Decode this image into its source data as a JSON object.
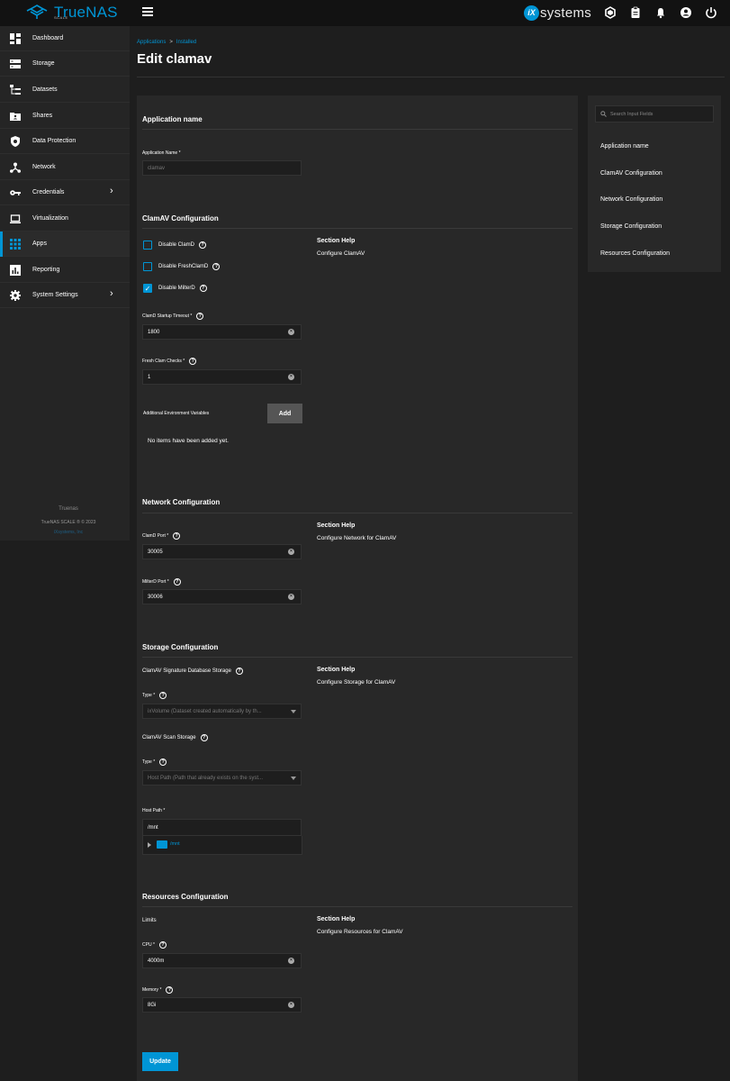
{
  "brand": {
    "name": "TrueNAS",
    "edition": "SCALE",
    "vendor_mark": "iX",
    "vendor_text": "systems"
  },
  "sidebar": {
    "items": [
      {
        "label": "Dashboard",
        "icon": "dashboard-icon"
      },
      {
        "label": "Storage",
        "icon": "storage-icon"
      },
      {
        "label": "Datasets",
        "icon": "datasets-icon"
      },
      {
        "label": "Shares",
        "icon": "shares-icon"
      },
      {
        "label": "Data Protection",
        "icon": "shield-icon"
      },
      {
        "label": "Network",
        "icon": "network-icon"
      },
      {
        "label": "Credentials",
        "icon": "key-icon"
      },
      {
        "label": "Virtualization",
        "icon": "laptop-icon"
      },
      {
        "label": "Apps",
        "icon": "apps-grid-icon"
      },
      {
        "label": "Reporting",
        "icon": "reporting-icon"
      },
      {
        "label": "System Settings",
        "icon": "gear-icon"
      }
    ],
    "footer_hostname": "Truenas",
    "footer_copyright": "TrueNAS SCALE ® © 2023",
    "footer_company": "iXsystems, Inc"
  },
  "breadcrumb": {
    "parent": "Applications",
    "separator": ">",
    "current": "Installed"
  },
  "page_title": "Edit clamav",
  "sections": {
    "app_name": {
      "title": "Application name",
      "field_label": "Application Name *",
      "field_value": "clamav"
    },
    "clamav": {
      "title": "ClamAV Configuration",
      "disable_clamd": "Disable ClamD",
      "disable_freshclamd": "Disable FreshClamD",
      "disable_milterd": "Disable MilterD",
      "startup_timeout_label": "ClamD Startup Timeout *",
      "startup_timeout_value": "1800",
      "fresh_checks_label": "Fresh Clam Checks *",
      "fresh_checks_value": "1",
      "env_vars_label": "Additional Environment Variables",
      "add_label": "Add",
      "no_items": "No items have been added yet.",
      "help_title": "Section Help",
      "help_text": "Configure ClamAV"
    },
    "network": {
      "title": "Network Configuration",
      "clamd_port_label": "ClamD Port *",
      "clamd_port_value": "30005",
      "milterd_port_label": "MilterD Port *",
      "milterd_port_value": "30006",
      "help_title": "Section Help",
      "help_text": "Configure Network for ClamAV"
    },
    "storage": {
      "title": "Storage Configuration",
      "sig_db_label": "ClamAV Signature Database Storage",
      "type_label": "Type *",
      "sig_db_type_value": "ixVolume (Dataset created automatically by th...",
      "scan_label": "ClamAV Scan Storage",
      "scan_type_value": "Host Path (Path that already exists on the syst...",
      "host_path_label": "Host Path *",
      "host_path_value": "/mnt",
      "tree_node": "/mnt",
      "help_title": "Section Help",
      "help_text": "Configure Storage for ClamAV"
    },
    "resources": {
      "title": "Resources Configuration",
      "limits_label": "Limits",
      "cpu_label": "CPU *",
      "cpu_value": "4000m",
      "memory_label": "Memory *",
      "memory_value": "8Gi",
      "help_title": "Section Help",
      "help_text": "Configure Resources for ClamAV"
    }
  },
  "update_label": "Update",
  "toc": {
    "search_placeholder": "Search Input Fields",
    "items": [
      "Application name",
      "ClamAV Configuration",
      "Network Configuration",
      "Storage Configuration",
      "Resources Configuration"
    ]
  },
  "colors": {
    "accent": "#0095d5",
    "bg": "#1e1e1e",
    "panel": "#282828",
    "sidebar": "#252525",
    "topbar": "#121212"
  }
}
